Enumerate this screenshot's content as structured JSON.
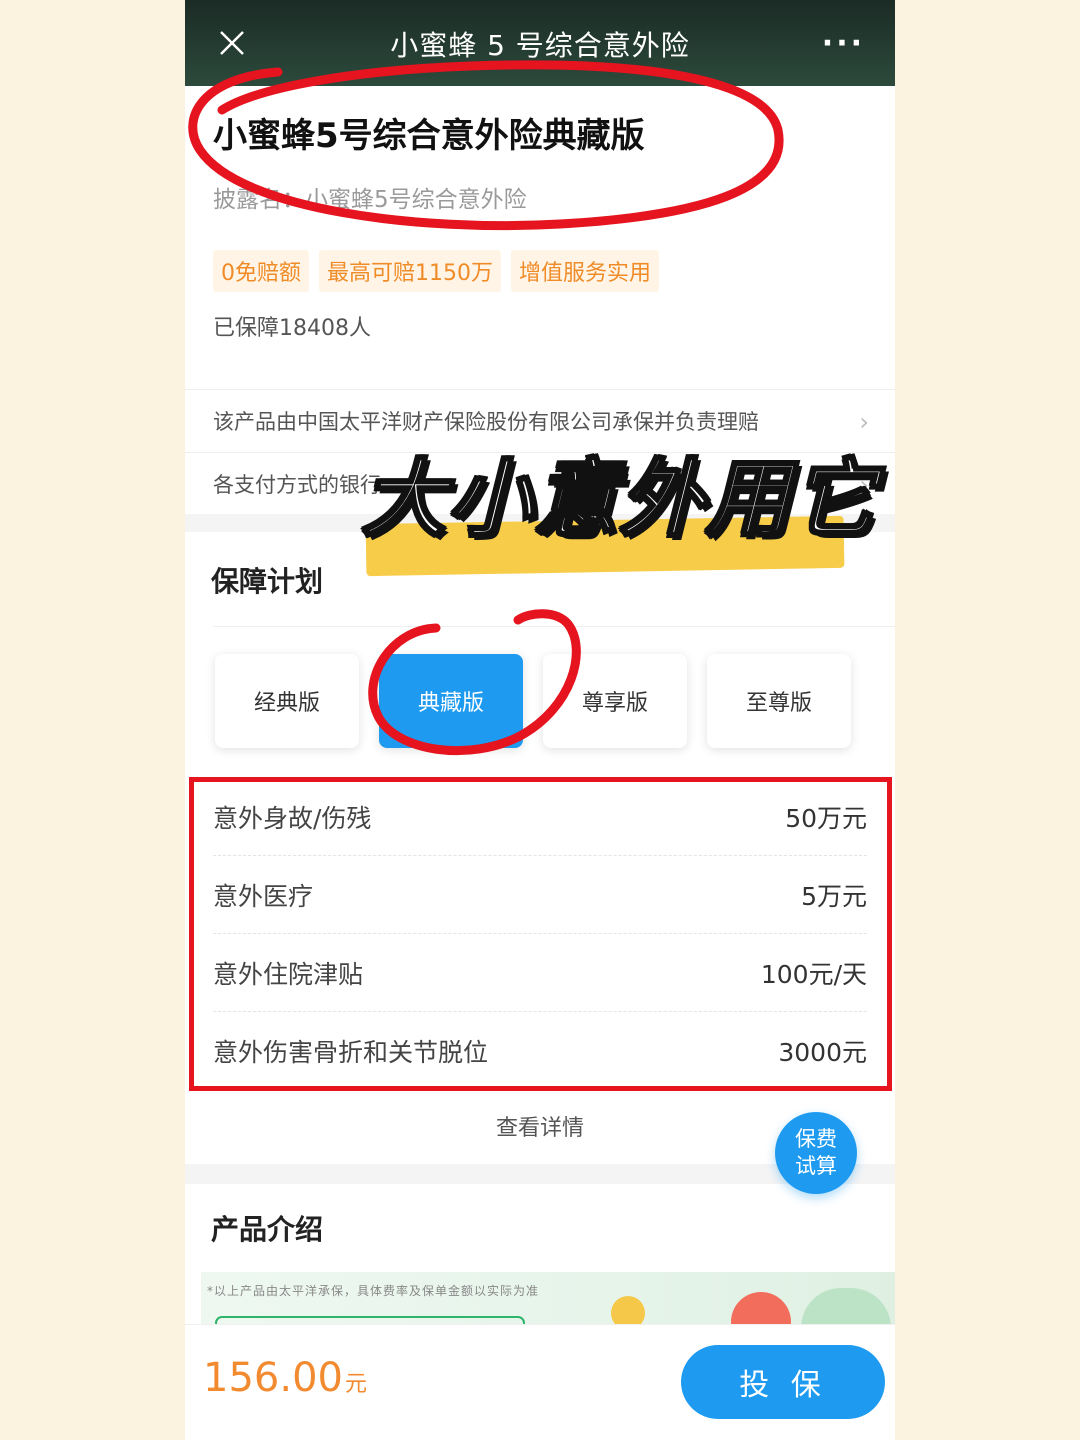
{
  "nav": {
    "title": "小蜜蜂 5 号综合意外险",
    "more": "···"
  },
  "product": {
    "title": "小蜜蜂5号综合意外险典藏版",
    "disclosure": "披露名：小蜜蜂5号综合意外险",
    "tags": [
      "0免赔额",
      "最高可赔1150万",
      "增值服务实用"
    ],
    "insured_count": "已保障18408人"
  },
  "links": {
    "underwriter": "该产品由中国太平洋财产保险股份有限公司承保并负责理赔",
    "payment": "各支付方式的银行"
  },
  "plan_section": {
    "title": "保障计划",
    "plans": [
      "经典版",
      "典藏版",
      "尊享版",
      "至尊版"
    ],
    "selected_index": 1
  },
  "coverage": [
    {
      "name": "意外身故/伤残",
      "value": "50万元"
    },
    {
      "name": "意外医疗",
      "value": "5万元"
    },
    {
      "name": "意外住院津贴",
      "value": "100元/天"
    },
    {
      "name": "意外伤害骨折和关节脱位",
      "value": "3000元"
    }
  ],
  "details_link": "查看详情",
  "calc_button": {
    "line1": "保费",
    "line2": "试算"
  },
  "intro_section": {
    "title": "产品介绍",
    "note": "*以上产品由太平洋承保，具体费率及保单金额以实际为准"
  },
  "footer": {
    "price": "156.00",
    "unit": "元",
    "buy_label": "投 保"
  },
  "overlay": {
    "caption": "大小意外用它"
  },
  "colors": {
    "accent": "#1e9bf0",
    "price": "#f28a30",
    "tag_text": "#f08c28",
    "annotation_red": "#e5141f",
    "highlight_yellow": "#f7cc48"
  }
}
